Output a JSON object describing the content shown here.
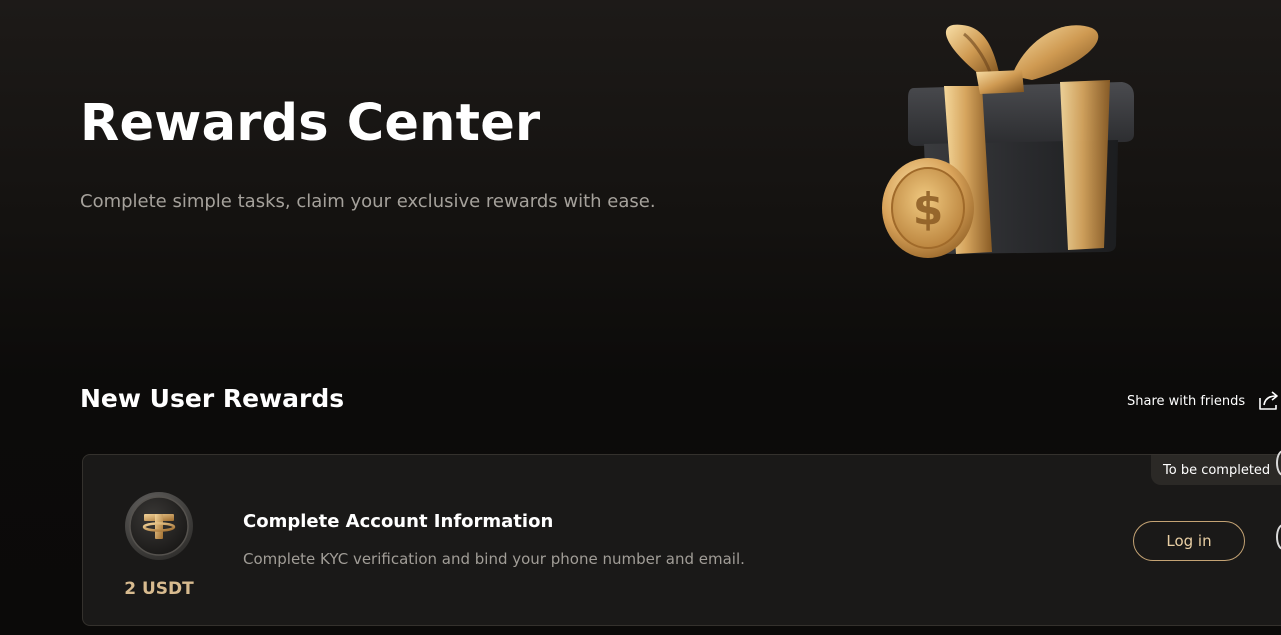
{
  "hero": {
    "title": "Rewards Center",
    "subtitle": "Complete simple tasks, claim your exclusive rewards with ease."
  },
  "new_user_rewards": {
    "title": "New User Rewards",
    "share_label": "Share with friends",
    "share_icon": "share-icon",
    "tasks": [
      {
        "reward_icon": "usdt-coin-icon",
        "reward_amount": "2 USDT",
        "title": "Complete Account Information",
        "description": "Complete KYC verification and bind your phone number and email.",
        "status": "To be completed",
        "action_label": "Log in"
      }
    ]
  },
  "colors": {
    "background": "#0c0b0a",
    "card_background": "#1a1918",
    "accent_gold": "#c4a374",
    "reward_amount": "#d8bb8f",
    "muted_text": "#a19d97"
  }
}
